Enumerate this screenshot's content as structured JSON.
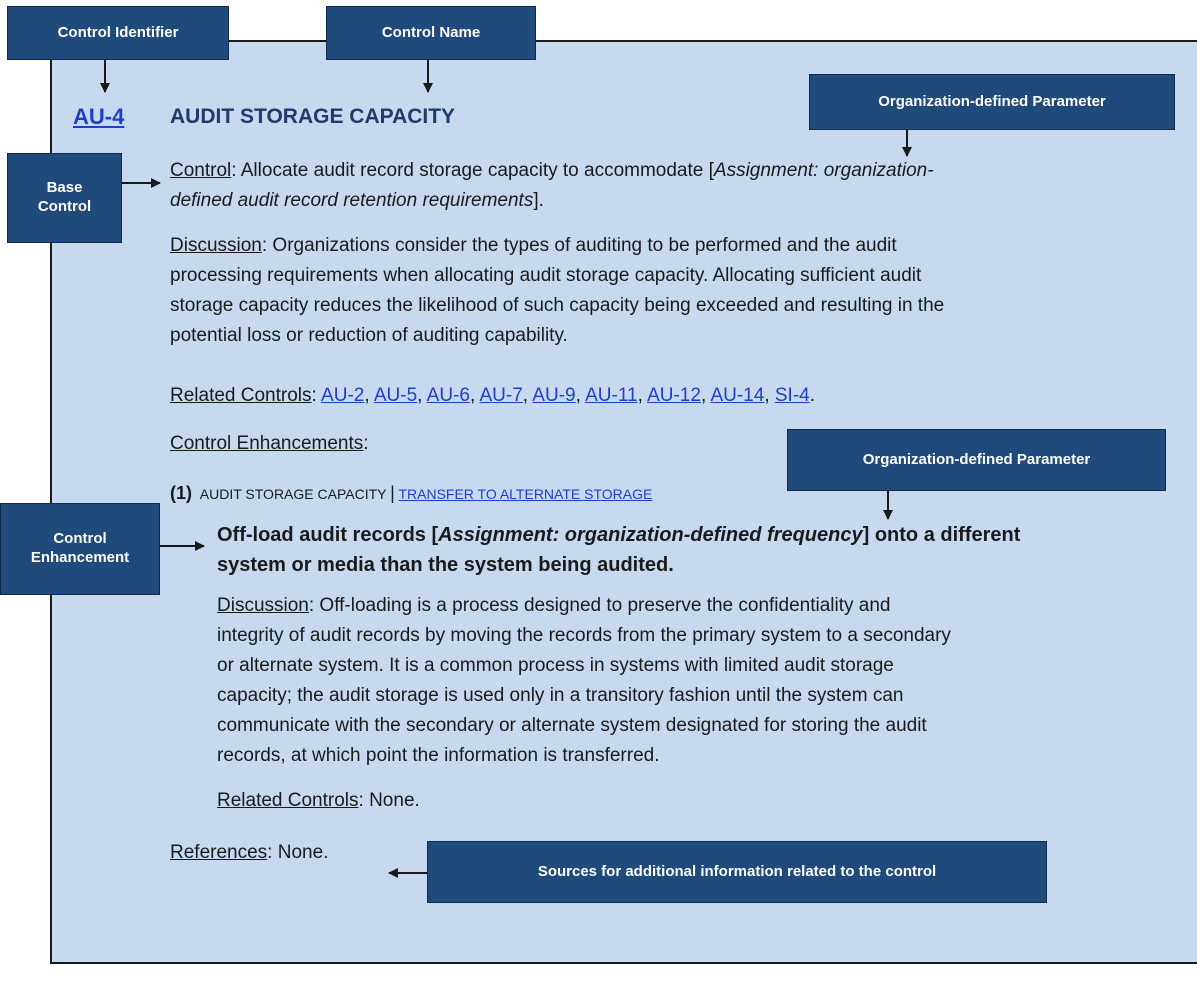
{
  "callouts": {
    "control_identifier": "Control Identifier",
    "control_name": "Control Name",
    "org_param_1": "Organization-defined Parameter",
    "base_control_line1": "Base",
    "base_control_line2": "Control",
    "org_param_2": "Organization-defined Parameter",
    "control_enh_line1": "Control",
    "control_enh_line2": "Enhancement",
    "sources": "Sources for additional information related to the control"
  },
  "control": {
    "id": "AU-4",
    "name": "AUDIT STORAGE CAPACITY",
    "control_label": "Control",
    "control_text_a": ":  Allocate audit record storage capacity to accommodate [",
    "control_assign_a": "Assignment: organization-",
    "control_assign_b": "defined audit record retention requirements",
    "control_text_b": "].",
    "discussion_label": "Discussion",
    "discussion_lines": [
      ":  Organizations consider the types of auditing to be performed and the audit",
      "processing requirements when allocating audit storage capacity. Allocating sufficient audit",
      "storage capacity reduces the likelihood of such capacity being exceeded and resulting in the",
      "potential loss or reduction of auditing capability."
    ],
    "related_label": "Related Controls",
    "related_sep": ":  ",
    "related": [
      "AU-2",
      "AU-5",
      "AU-6",
      "AU-7",
      "AU-9",
      "AU-11",
      "AU-12",
      "AU-14",
      "SI-4"
    ],
    "enh_label": "Control Enhancements",
    "enh_colon": ":"
  },
  "enhancement": {
    "number": "(1)",
    "parent": "AUDIT STORAGE CAPACITY",
    "bar": "|",
    "title": "TRANSFER TO ALTERNATE STORAGE",
    "stmt_a": "Off-load audit records [",
    "stmt_assign": "Assignment: organization-defined frequency",
    "stmt_b": "] onto a different",
    "stmt_line2": "system or media than the system being audited.",
    "discussion_label": "Discussion",
    "discussion_lines": [
      ":  Off-loading is a process designed to preserve the confidentiality and",
      "integrity of audit records by moving the records from the primary system to a secondary",
      "or alternate system. It is a common process in systems with limited audit storage",
      "capacity; the audit storage is used only in a transitory fashion until the system can",
      "communicate with the secondary or alternate system designated for storing the audit",
      "records, at which point the information is transferred."
    ],
    "related_label": "Related Controls",
    "related_text": ":  None."
  },
  "references": {
    "label": "References",
    "text": ":  None."
  }
}
